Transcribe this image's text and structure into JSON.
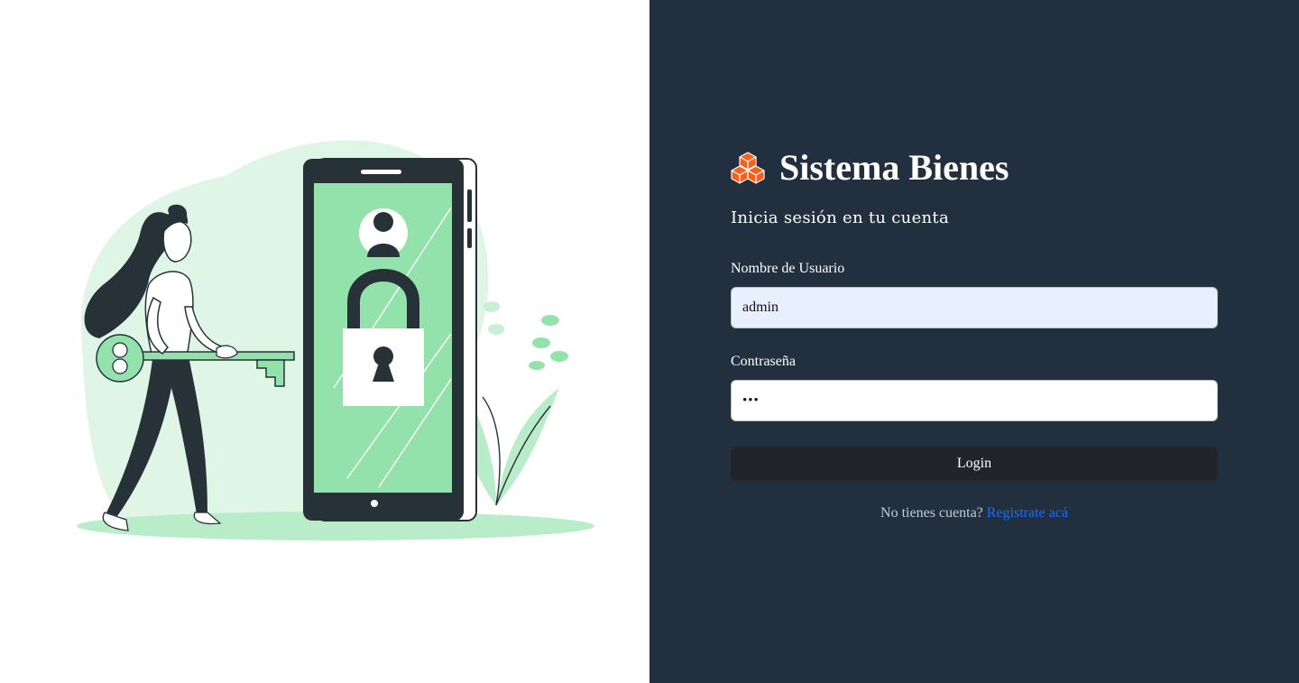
{
  "brand": {
    "title": "Sistema Bienes",
    "icon": "cubes-icon",
    "icon_color": "#fd5e1a"
  },
  "subtitle": "Inicia sesión en tu cuenta",
  "form": {
    "username_label": "Nombre de Usuario",
    "username_value": "admin",
    "password_label": "Contraseña",
    "password_value": "•••",
    "submit_label": "Login"
  },
  "register": {
    "prompt": "No tienes cuenta?",
    "link_label": "Registrate acá"
  },
  "colors": {
    "panel_background": "#222f3e",
    "button_background": "#212529",
    "link_color": "#1d6cf5",
    "illustration_accent": "#94e2ab"
  }
}
